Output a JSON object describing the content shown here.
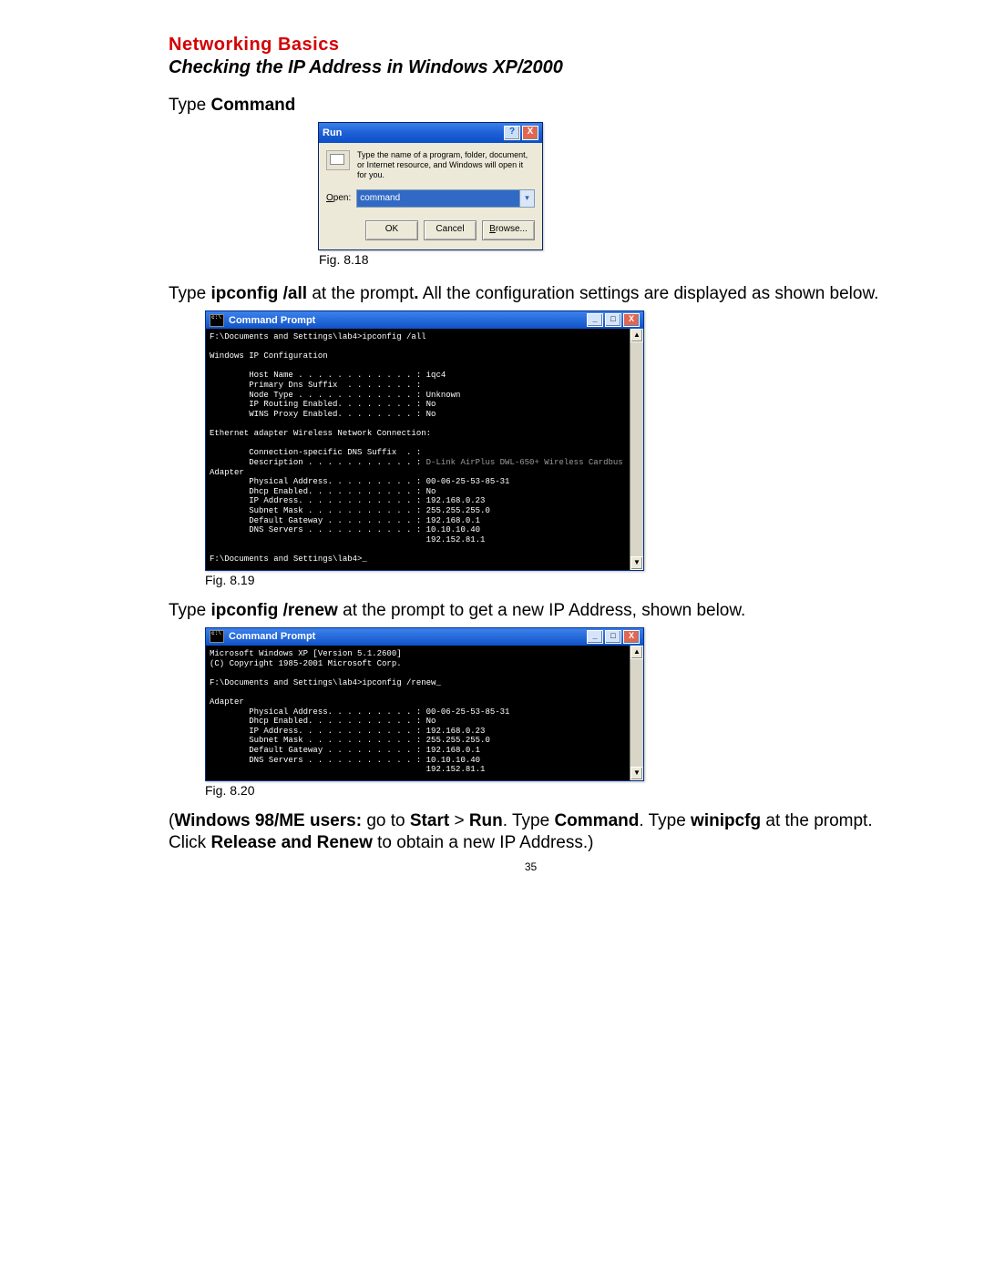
{
  "heading_red": "Networking   Basics",
  "heading_sub": "Checking the IP Address in Windows XP/2000",
  "type_prefix": "Type ",
  "type_bold": "Command",
  "run": {
    "title": "Run",
    "help": "?",
    "close": "X",
    "desc": "Type the name of a program, folder, document, or Internet resource, and Windows will open it for you.",
    "open_u": "O",
    "open_rest": "pen:",
    "value": "command",
    "ok": "OK",
    "cancel": "Cancel",
    "browse_u": "B",
    "browse_rest": "rowse..."
  },
  "fig1": "Fig. 8.18",
  "para1a": "Type ",
  "para1b": "ipconfig /all",
  "para1c": " at the prompt",
  "para1d": ".",
  "para1e": "  All the configuration settings are displayed as shown below.",
  "cmd1": {
    "title": "Command Prompt",
    "min": "_",
    "max": "□",
    "close": "X",
    "up": "▲",
    "down": "▼",
    "body_top": "F:\\Documents and Settings\\lab4>ipconfig /all\n\nWindows IP Configuration\n\n        Host Name . . . . . . . . . . . . : iqc4\n        Primary Dns Suffix  . . . . . . . :\n        Node Type . . . . . . . . . . . . : Unknown\n        IP Routing Enabled. . . . . . . . : No\n        WINS Proxy Enabled. . . . . . . . : No\n\nEthernet adapter Wireless Network Connection:\n\n        Connection-specific DNS Suffix  . :",
    "body_desc_line": "        Description . . . . . . . . . . . : ",
    "body_desc_dim": "D-Link AirPlus DWL-650+ Wireless Cardbus",
    "body_bottom": "Adapter\n        Physical Address. . . . . . . . . : 00-06-25-53-85-31\n        Dhcp Enabled. . . . . . . . . . . : No\n        IP Address. . . . . . . . . . . . : 192.168.0.23\n        Subnet Mask . . . . . . . . . . . : 255.255.255.0\n        Default Gateway . . . . . . . . . : 192.168.0.1\n        DNS Servers . . . . . . . . . . . : 10.10.10.40\n                                            192.152.81.1\n\nF:\\Documents and Settings\\lab4>_"
  },
  "fig2": "Fig. 8.19",
  "para2a": "Type ",
  "para2b": "ipconfig /renew",
  "para2c": " at the prompt to get a new IP Address, shown below.",
  "cmd2": {
    "title": "Command Prompt",
    "min": "_",
    "max": "□",
    "close": "X",
    "up": "▲",
    "down": "▼",
    "body": "Microsoft Windows XP [Version 5.1.2600]\n(C) Copyright 1985-2001 Microsoft Corp.\n\nF:\\Documents and Settings\\lab4>ipconfig /renew_\n\nAdapter\n        Physical Address. . . . . . . . . : 00-06-25-53-85-31\n        Dhcp Enabled. . . . . . . . . . . : No\n        IP Address. . . . . . . . . . . . : 192.168.0.23\n        Subnet Mask . . . . . . . . . . . : 255.255.255.0\n        Default Gateway . . . . . . . . . : 192.168.0.1\n        DNS Servers . . . . . . . . . . . : 10.10.10.40\n                                            192.152.81.1"
  },
  "fig3": "Fig. 8.20",
  "para3_parts": {
    "p0": "(",
    "p1": "Windows 98/ME users:",
    "p2": "  go to ",
    "p3": "Start",
    "p4": " > ",
    "p5": "Run",
    "p6": ".  Type ",
    "p7": "Command",
    "p8": ".  Type ",
    "p9": "winipcfg",
    "p10": " at the prompt.  Click ",
    "p11": "Release and Renew",
    "p12": " to obtain a new IP Address.)"
  },
  "page_num": "35"
}
